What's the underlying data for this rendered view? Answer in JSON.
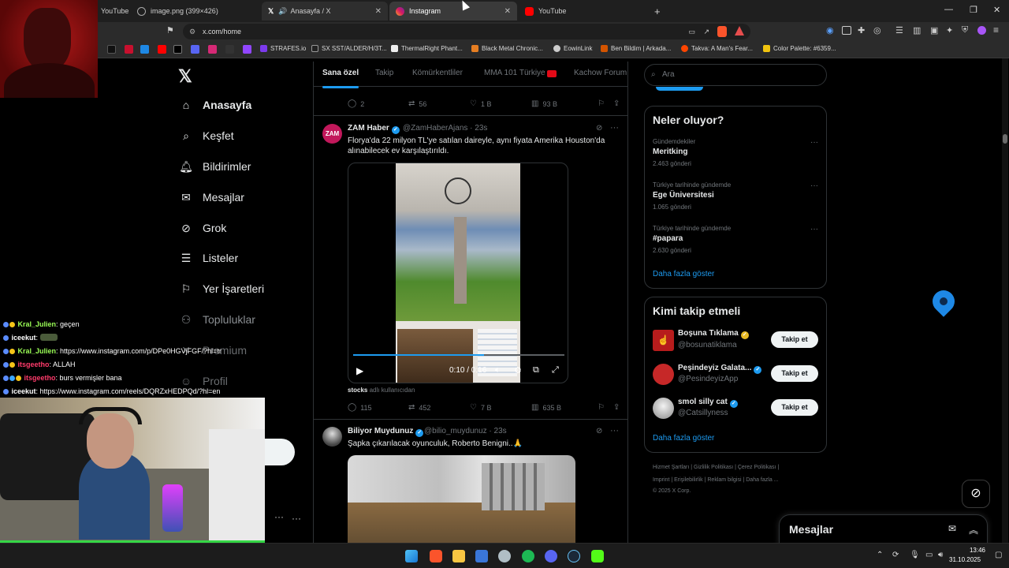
{
  "browser": {
    "tabs": [
      {
        "label": "YouTube",
        "active": false
      },
      {
        "label": "image.png (399×426)",
        "active": false
      },
      {
        "label": "Anasayfa / X",
        "active": false
      },
      {
        "label": "Instagram",
        "active": true
      },
      {
        "label": "YouTube",
        "active": false
      }
    ],
    "url": "x.com/home",
    "bookmarks": [
      "STRAFES.io",
      "SX SST/ALDER/H/3T...",
      "ThermalRight Phant...",
      "Black Metal Chronic...",
      "EowinLink",
      "Ben Bildim | Arkada...",
      "Takva: A Man's Fear...",
      "Color Palette: #6359..."
    ]
  },
  "nav": {
    "items": [
      {
        "label": "Anasayfa",
        "icon": "home-icon"
      },
      {
        "label": "Keşfet",
        "icon": "search-icon"
      },
      {
        "label": "Bildirimler",
        "icon": "bell-icon"
      },
      {
        "label": "Mesajlar",
        "icon": "mail-icon"
      },
      {
        "label": "Grok",
        "icon": "grok-icon"
      },
      {
        "label": "Listeler",
        "icon": "list-icon"
      },
      {
        "label": "Yer İşaretleri",
        "icon": "bookmark-icon"
      },
      {
        "label": "Topluluklar",
        "icon": "people-icon"
      },
      {
        "label": "Premium",
        "icon": "x-icon"
      },
      {
        "label": "Profil",
        "icon": "user-icon"
      }
    ]
  },
  "feed": {
    "tabs": [
      "Sana özel",
      "Takip",
      "Kömürkentliler",
      "MMA 101 Türkiye",
      "Kachow Forum"
    ],
    "prev_actions": {
      "replies": "2",
      "retweets": "56",
      "likes": "1 B",
      "views": "93 B"
    },
    "tweets": [
      {
        "name": "ZAM Haber",
        "handle": "@ZamHaberAjans · 23s",
        "text": "Florya'da 22 milyon TL'ye satılan daireyle, aynı fiyata Amerika Houston'da alınabilecek ev karşılaştırıldı.",
        "video_time": "0:10 / 0:16",
        "caption": "stocks",
        "caption_suffix": "adlı kullanıcıdan",
        "replies": "115",
        "retweets": "452",
        "likes": "7 B",
        "views": "635 B"
      },
      {
        "name": "Biliyor Muydunuz",
        "handle": "@bilio_muydunuz · 23s",
        "text": "Şapka çıkarılacak oyunculuk, Roberto Benigni..🙏"
      }
    ]
  },
  "sidebar": {
    "search_placeholder": "Ara",
    "trends_title": "Neler oluyor?",
    "trends": [
      {
        "category": "Gündemdekiler",
        "name": "Meritking",
        "count": "2.463 gönderi"
      },
      {
        "category": "Türkiye tarihinde gündemde",
        "name": "Ege Üniversitesi",
        "count": "1.065 gönderi"
      },
      {
        "category": "Türkiye tarihinde gündemde",
        "name": "#papara",
        "count": "2.630 gönderi"
      }
    ],
    "trends_more": "Daha fazla göster",
    "follow_title": "Kimi takip etmeli",
    "follow": [
      {
        "name": "Boşuna Tıklama",
        "handle": "@bosunatiklama",
        "button": "Takip et"
      },
      {
        "name": "Peşindeyiz Galata...",
        "handle": "@PesindeyizApp",
        "button": "Takip et"
      },
      {
        "name": "smol silly cat",
        "handle": "@Catsillyness",
        "button": "Takip et"
      }
    ],
    "follow_more": "Daha fazla göster",
    "footer_line1": "Hizmet Şartları  |  Gizlilik Politikası  |  Çerez Politikası  |",
    "footer_line2": "Imprint  |  Erişilebilirlik  |  Reklam bilgisi  |  Daha fazla ...",
    "footer_line3": "© 2025 X Corp."
  },
  "messages_drawer": {
    "title": "Mesajlar"
  },
  "chat": [
    {
      "user": "Kral_Julien",
      "msg": ": geçen",
      "color": "#9cff57"
    },
    {
      "user": "iceekut",
      "msg": ":",
      "color": "#ffffff"
    },
    {
      "user": "Kral_Julien",
      "msg": ": https://www.instagram.com/p/DPe0HGVjFGF/?hl=tr",
      "color": "#9cff57"
    },
    {
      "user": "itsgeetho",
      "msg": ": ALLAH",
      "color": "#ff3b6b"
    },
    {
      "user": "itsgeetho",
      "msg": ": burs vermişler bana",
      "color": "#ff3b6b"
    },
    {
      "user": "iceekut",
      "msg": ": https://www.instagram.com/reels/DQRZxHEDPQd/?hl=en",
      "color": "#ffffff"
    }
  ],
  "clock": {
    "time": "13:46",
    "date": "31.10.2025"
  }
}
